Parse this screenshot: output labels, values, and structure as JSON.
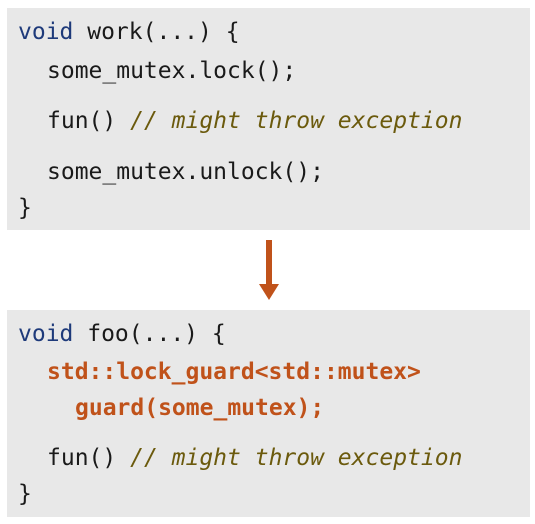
{
  "colors": {
    "box_background": "#e8e8e8",
    "keyword": "#1e3a7a",
    "comment": "#6b5a0d",
    "accent": "#c0521a",
    "text": "#1a1a1a"
  },
  "top_block": {
    "line1_keyword": "void",
    "line1_rest": " work(...) {",
    "line2": "some_mutex.lock();",
    "line3_code": "fun() ",
    "line3_comment": "// might throw exception",
    "line4": "some_mutex.unlock();",
    "line5": "}"
  },
  "arrow_icon": "down-arrow-icon",
  "bottom_block": {
    "line1_keyword": "void",
    "line1_rest": " foo(...) {",
    "line2": "std::lock_guard<std::mutex>",
    "line3": "guard(some_mutex);",
    "line4_code": "fun() ",
    "line4_comment": "// might throw exception",
    "line5": "}"
  }
}
